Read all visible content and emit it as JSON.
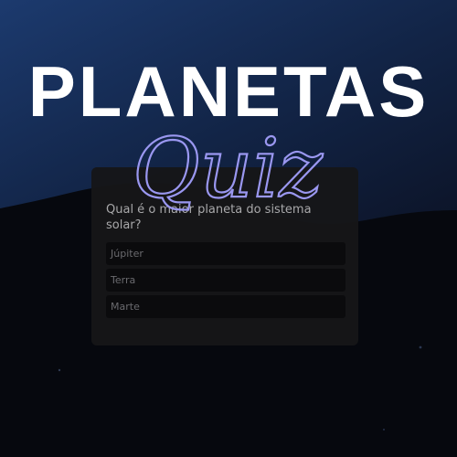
{
  "title": "PLANETAS",
  "subtitle_script": "Quiz",
  "quiz": {
    "question": "Qual é o maior planeta do sistema solar?",
    "options": [
      "Júpiter",
      "Terra",
      "Marte"
    ]
  },
  "colors": {
    "background": "#06080e",
    "wave_top": "#1c3a6e",
    "card": "#161618",
    "option": "#0b0b0d",
    "script_accent": "#9a97f0",
    "title": "#ffffff"
  }
}
